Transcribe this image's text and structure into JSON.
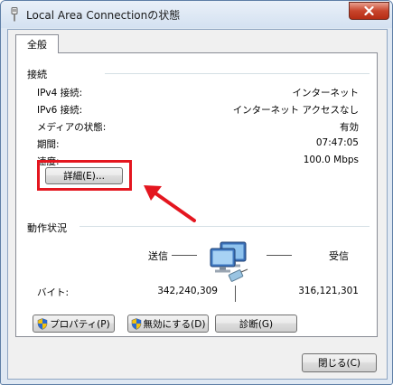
{
  "window": {
    "title": "Local Area Connectionの状態",
    "close_icon": "close-x-icon"
  },
  "tabs": [
    {
      "label": "全般"
    }
  ],
  "connection": {
    "section_label": "接続",
    "rows": [
      {
        "label": "IPv4 接続:",
        "value": "インターネット"
      },
      {
        "label": "IPv6 接続:",
        "value": "インターネット アクセスなし"
      },
      {
        "label": "メディアの状態:",
        "value": "有効"
      },
      {
        "label": "期間:",
        "value": "07:47:05"
      },
      {
        "label": "速度:",
        "value": "100.0 Mbps"
      }
    ],
    "details_button": "詳細(E)..."
  },
  "activity": {
    "section_label": "動作状況",
    "sent_label": "送信",
    "received_label": "受信",
    "bytes_label": "バイト:",
    "bytes_sent": "342,240,309",
    "bytes_received": "316,121,301"
  },
  "actions": {
    "properties": "プロパティ(P)",
    "disable": "無効にする(D)",
    "diagnose": "診断(G)"
  },
  "footer": {
    "close": "閉じる(C)"
  },
  "annotation": {
    "color": "#e4161f"
  }
}
